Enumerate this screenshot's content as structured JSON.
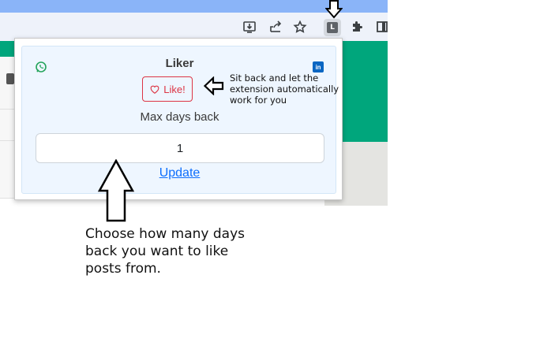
{
  "popup": {
    "title": "Liker",
    "like_button_label": "Like!",
    "max_days_label": "Max days back",
    "days_value": "1",
    "update_link": "Update",
    "linkedin_icon_text": "in"
  },
  "browser": {
    "extension_icon_letter": "L"
  },
  "annotations": {
    "like_hint": "Sit back and let the extension automatically work  for you",
    "days_hint": "Choose how many days back you want to like posts from."
  },
  "colors": {
    "accent_blue": "#0d6efd",
    "like_red": "#dc3545",
    "whatsapp_green": "#25a45c",
    "linkedin_blue": "#0a66c2",
    "card_bg": "#eef6ff",
    "page_teal": "#00a67c",
    "tabstrip_blue": "#8ab4f8"
  },
  "icons": [
    "whatsapp-icon",
    "linkedin-icon",
    "heart-icon",
    "install-icon",
    "share-icon",
    "star-icon",
    "puzzle-icon",
    "sidepanel-icon"
  ]
}
